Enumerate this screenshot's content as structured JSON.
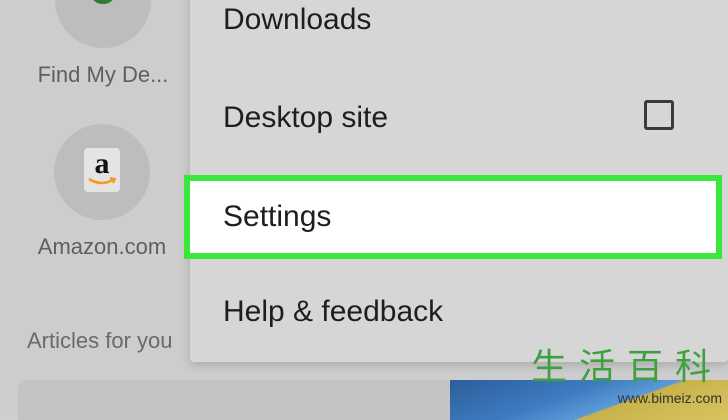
{
  "shortcuts": [
    {
      "label": "Find My De...",
      "icon": "find-my-device-icon"
    },
    {
      "label": "Amazon.com",
      "icon": "amazon-icon"
    }
  ],
  "amazon_letter": "a",
  "articles_label": "Articles for you",
  "menu": {
    "items": [
      {
        "label": "Downloads"
      },
      {
        "label": "Desktop site",
        "checkbox_checked": false
      },
      {
        "label": "Settings",
        "highlighted": true
      },
      {
        "label": "Help & feedback"
      }
    ]
  },
  "highlight_color": "#39e83b",
  "watermark": {
    "chars": [
      "生",
      "活",
      "百",
      "科"
    ],
    "url": "www.bimeiz.com"
  }
}
